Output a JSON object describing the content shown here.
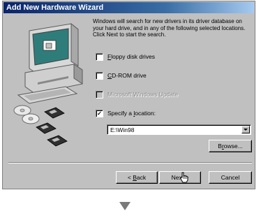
{
  "window": {
    "title": "Add New Hardware Wizard"
  },
  "intro_text": "Windows will search for new drivers in its driver database on your hard drive, and in any of the following selected locations. Click Next to start the search.",
  "options": [
    {
      "label_access": "F",
      "label_rest": "loppy disk drives",
      "checked": false,
      "enabled": true
    },
    {
      "label_access": "C",
      "label_rest": "D-ROM drive",
      "checked": false,
      "enabled": true
    },
    {
      "label": "Microsoft Windows Update",
      "checked": false,
      "enabled": false
    },
    {
      "label_prefix": "Specify a ",
      "label_access": "l",
      "label_rest": "ocation:",
      "checked": true,
      "enabled": true
    }
  ],
  "location_value": "E:\\Win98",
  "buttons": {
    "browse_access": "r",
    "browse_prefix": "B",
    "browse_rest": "owse...",
    "back_prefix": "< ",
    "back_access": "B",
    "back_rest": "ack",
    "next": "Next >",
    "cancel": "Cancel"
  },
  "colors": {
    "dialog_face": "#c0c0c0",
    "titlebar_start": "#0a246a",
    "titlebar_end": "#a6caf0",
    "disabled_text": "#8a8a8a"
  },
  "icons": [
    "computer-icon",
    "cd-discs-icon",
    "floppy-disks-icon",
    "checkmark-icon",
    "dropdown-arrow-icon",
    "mouse-cursor-icon",
    "down-arrow-icon"
  ]
}
